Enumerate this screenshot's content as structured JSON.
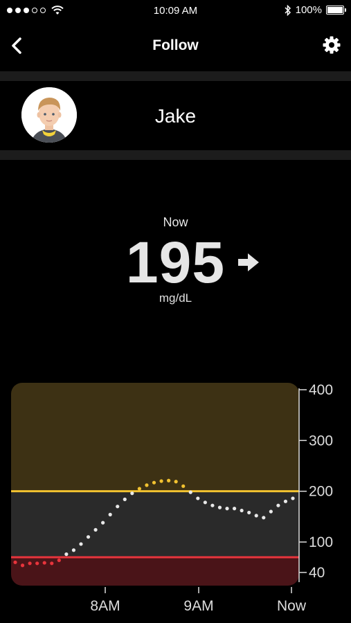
{
  "status_bar": {
    "time": "10:09 AM",
    "battery": "100%",
    "signal_dots": [
      true,
      true,
      true,
      false,
      false
    ]
  },
  "nav": {
    "title": "Follow",
    "back_icon": "chevron-left-icon",
    "settings_icon": "gear-icon"
  },
  "profile": {
    "name": "Jake"
  },
  "reading": {
    "label": "Now",
    "value": "195",
    "unit": "mg/dL",
    "trend": "right-arrow-icon (steady)"
  },
  "colors": {
    "high_zone": "#3d3114",
    "mid_zone": "#2a2a2a",
    "low_zone": "#4a1418",
    "high_line": "#f2c230",
    "low_line": "#e8343c",
    "point_normal": "#e8e8e8",
    "point_high": "#f2c230",
    "point_low": "#e8343c"
  },
  "chart_data": {
    "type": "scatter",
    "y_ticks": [
      "400",
      "300",
      "200",
      "100",
      "40"
    ],
    "x_ticks": [
      "8AM",
      "9AM",
      "Now"
    ],
    "ylim": [
      40,
      400
    ],
    "high_threshold": 200,
    "low_threshold": 70,
    "points": [
      {
        "t": 0,
        "v": 60
      },
      {
        "t": 0.04,
        "v": 54
      },
      {
        "t": 0.08,
        "v": 58
      },
      {
        "t": 0.12,
        "v": 58
      },
      {
        "t": 0.16,
        "v": 59
      },
      {
        "t": 0.2,
        "v": 58
      },
      {
        "t": 0.24,
        "v": 64
      },
      {
        "t": 0.28,
        "v": 76
      },
      {
        "t": 0.32,
        "v": 84
      },
      {
        "t": 0.36,
        "v": 96
      },
      {
        "t": 0.4,
        "v": 110
      },
      {
        "t": 0.44,
        "v": 124
      },
      {
        "t": 0.48,
        "v": 138
      },
      {
        "t": 0.52,
        "v": 154
      },
      {
        "t": 0.56,
        "v": 170
      },
      {
        "t": 0.6,
        "v": 184
      },
      {
        "t": 0.64,
        "v": 196
      },
      {
        "t": 0.68,
        "v": 205
      },
      {
        "t": 0.72,
        "v": 212
      },
      {
        "t": 0.76,
        "v": 217
      },
      {
        "t": 0.8,
        "v": 220
      },
      {
        "t": 0.84,
        "v": 221
      },
      {
        "t": 0.88,
        "v": 219
      },
      {
        "t": 0.92,
        "v": 210
      },
      {
        "t": 0.96,
        "v": 198
      },
      {
        "t": 1.0,
        "v": 186
      },
      {
        "t": 1.04,
        "v": 178
      },
      {
        "t": 1.08,
        "v": 172
      },
      {
        "t": 1.12,
        "v": 168
      },
      {
        "t": 1.16,
        "v": 166
      },
      {
        "t": 1.2,
        "v": 166
      },
      {
        "t": 1.24,
        "v": 162
      },
      {
        "t": 1.28,
        "v": 158
      },
      {
        "t": 1.32,
        "v": 152
      },
      {
        "t": 1.36,
        "v": 148
      },
      {
        "t": 1.4,
        "v": 160
      },
      {
        "t": 1.44,
        "v": 172
      },
      {
        "t": 1.48,
        "v": 180
      },
      {
        "t": 1.52,
        "v": 186
      }
    ]
  }
}
